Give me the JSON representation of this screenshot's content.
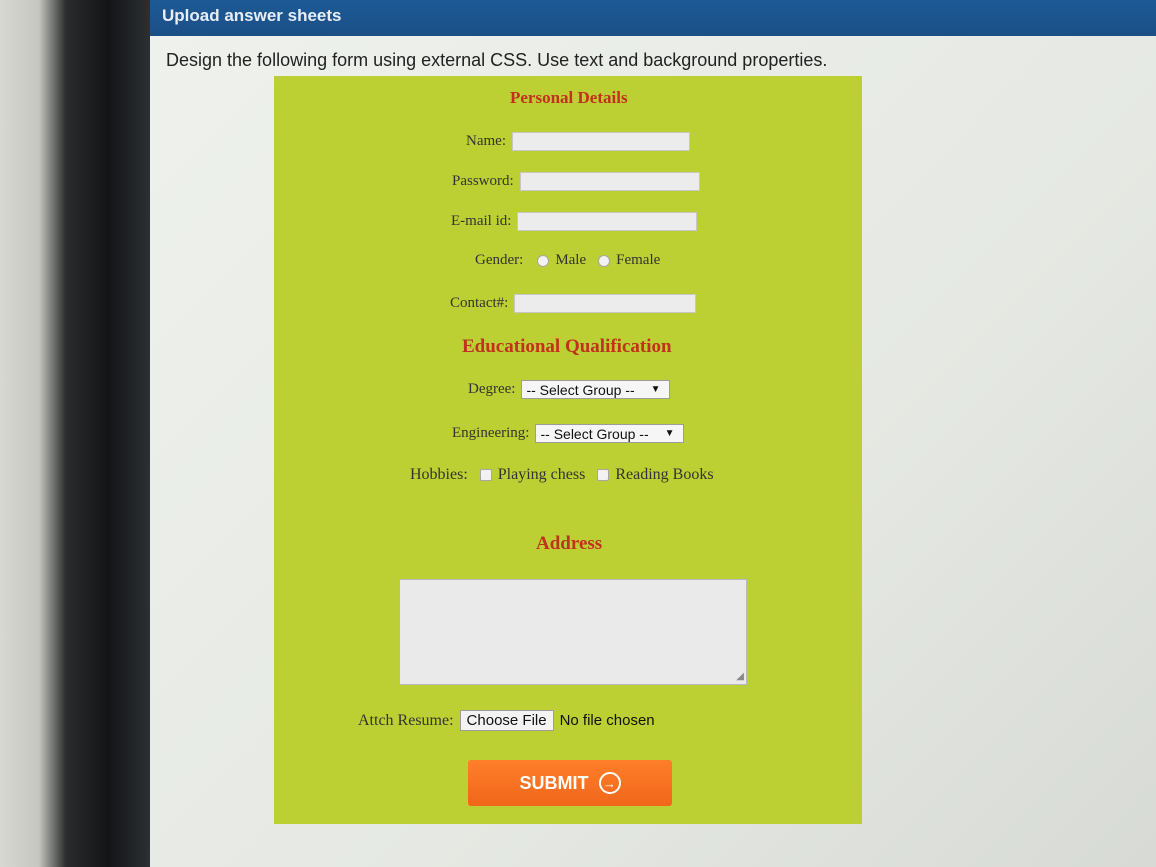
{
  "window": {
    "title": "Upload answer sheets"
  },
  "instruction": "Design the following form using external CSS. Use text and background properties.",
  "form": {
    "personal_title": "Personal Details",
    "name_label": "Name:",
    "password_label": "Password:",
    "email_label": "E-mail id:",
    "gender_label": "Gender:",
    "gender_options": [
      "Male",
      "Female"
    ],
    "contact_label": "Contact#:",
    "education_title": "Educational Qualification",
    "degree_label": "Degree:",
    "degree_select": "-- Select Group --",
    "engineering_label": "Engineering:",
    "engineering_select": "-- Select Group --",
    "hobbies_label": "Hobbies:",
    "hobby_options": [
      "Playing chess",
      "Reading Books"
    ],
    "address_title": "Address",
    "resume_label": "Attch Resume:",
    "choose_file_label": "Choose File",
    "file_status": "No file chosen",
    "submit_label": "SUBMIT"
  },
  "colors": {
    "form_background": "#bcd033",
    "section_title": "#c0311e",
    "submit_button": "#f0661a",
    "top_bar": "#1d5a96"
  }
}
